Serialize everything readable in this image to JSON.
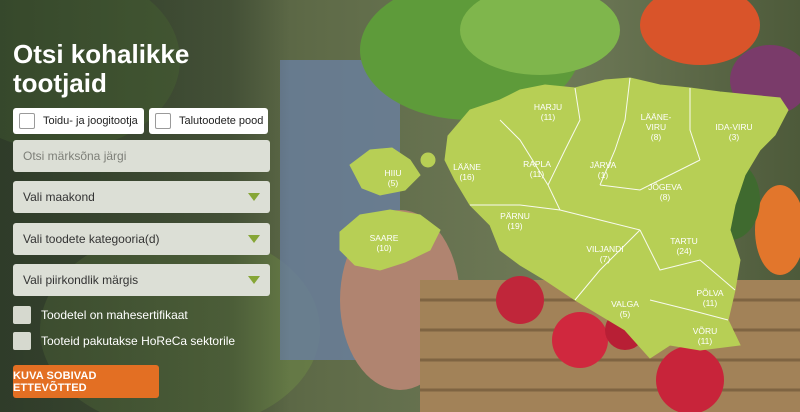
{
  "heading": "Otsi kohalikke tootjaid",
  "filters": {
    "food_producer": "Toidu- ja joogitootja",
    "farm_shop": "Talutoodete pood"
  },
  "search": {
    "placeholder": "Otsi märksõna järgi"
  },
  "selects": {
    "county": "Vali maakond",
    "category": "Vali toodete kategooria(d)",
    "regional_mark": "Vali piirkondlik märgis"
  },
  "options": {
    "organic": "Toodetel on mahesertifikaat",
    "horeca": "Tooteid pakutakse HoReCa sektorile"
  },
  "cta": "KUVA SOBIVAD ETTEVÕTTED",
  "colors": {
    "map_fill": "#b7cf55",
    "cta": "#e36f23",
    "caret": "#86a636"
  },
  "counties": [
    {
      "name": "HARJU",
      "count": "(11)"
    },
    {
      "name": "LÄÄNE-\nVIRU",
      "count": "(8)"
    },
    {
      "name": "IDA-VIRU",
      "count": "(3)"
    },
    {
      "name": "HIIU",
      "count": "(5)"
    },
    {
      "name": "LÄÄNE",
      "count": "(16)"
    },
    {
      "name": "RAPLA",
      "count": "(11)"
    },
    {
      "name": "JÄRVA",
      "count": "(1)"
    },
    {
      "name": "JÕGEVA",
      "count": "(8)"
    },
    {
      "name": "PÄRNU",
      "count": "(19)"
    },
    {
      "name": "SAARE",
      "count": "(10)"
    },
    {
      "name": "VILJANDI",
      "count": "(7)"
    },
    {
      "name": "TARTU",
      "count": "(24)"
    },
    {
      "name": "PÕLVA",
      "count": "(11)"
    },
    {
      "name": "VALGA",
      "count": "(5)"
    },
    {
      "name": "VÕRU",
      "count": "(11)"
    }
  ]
}
